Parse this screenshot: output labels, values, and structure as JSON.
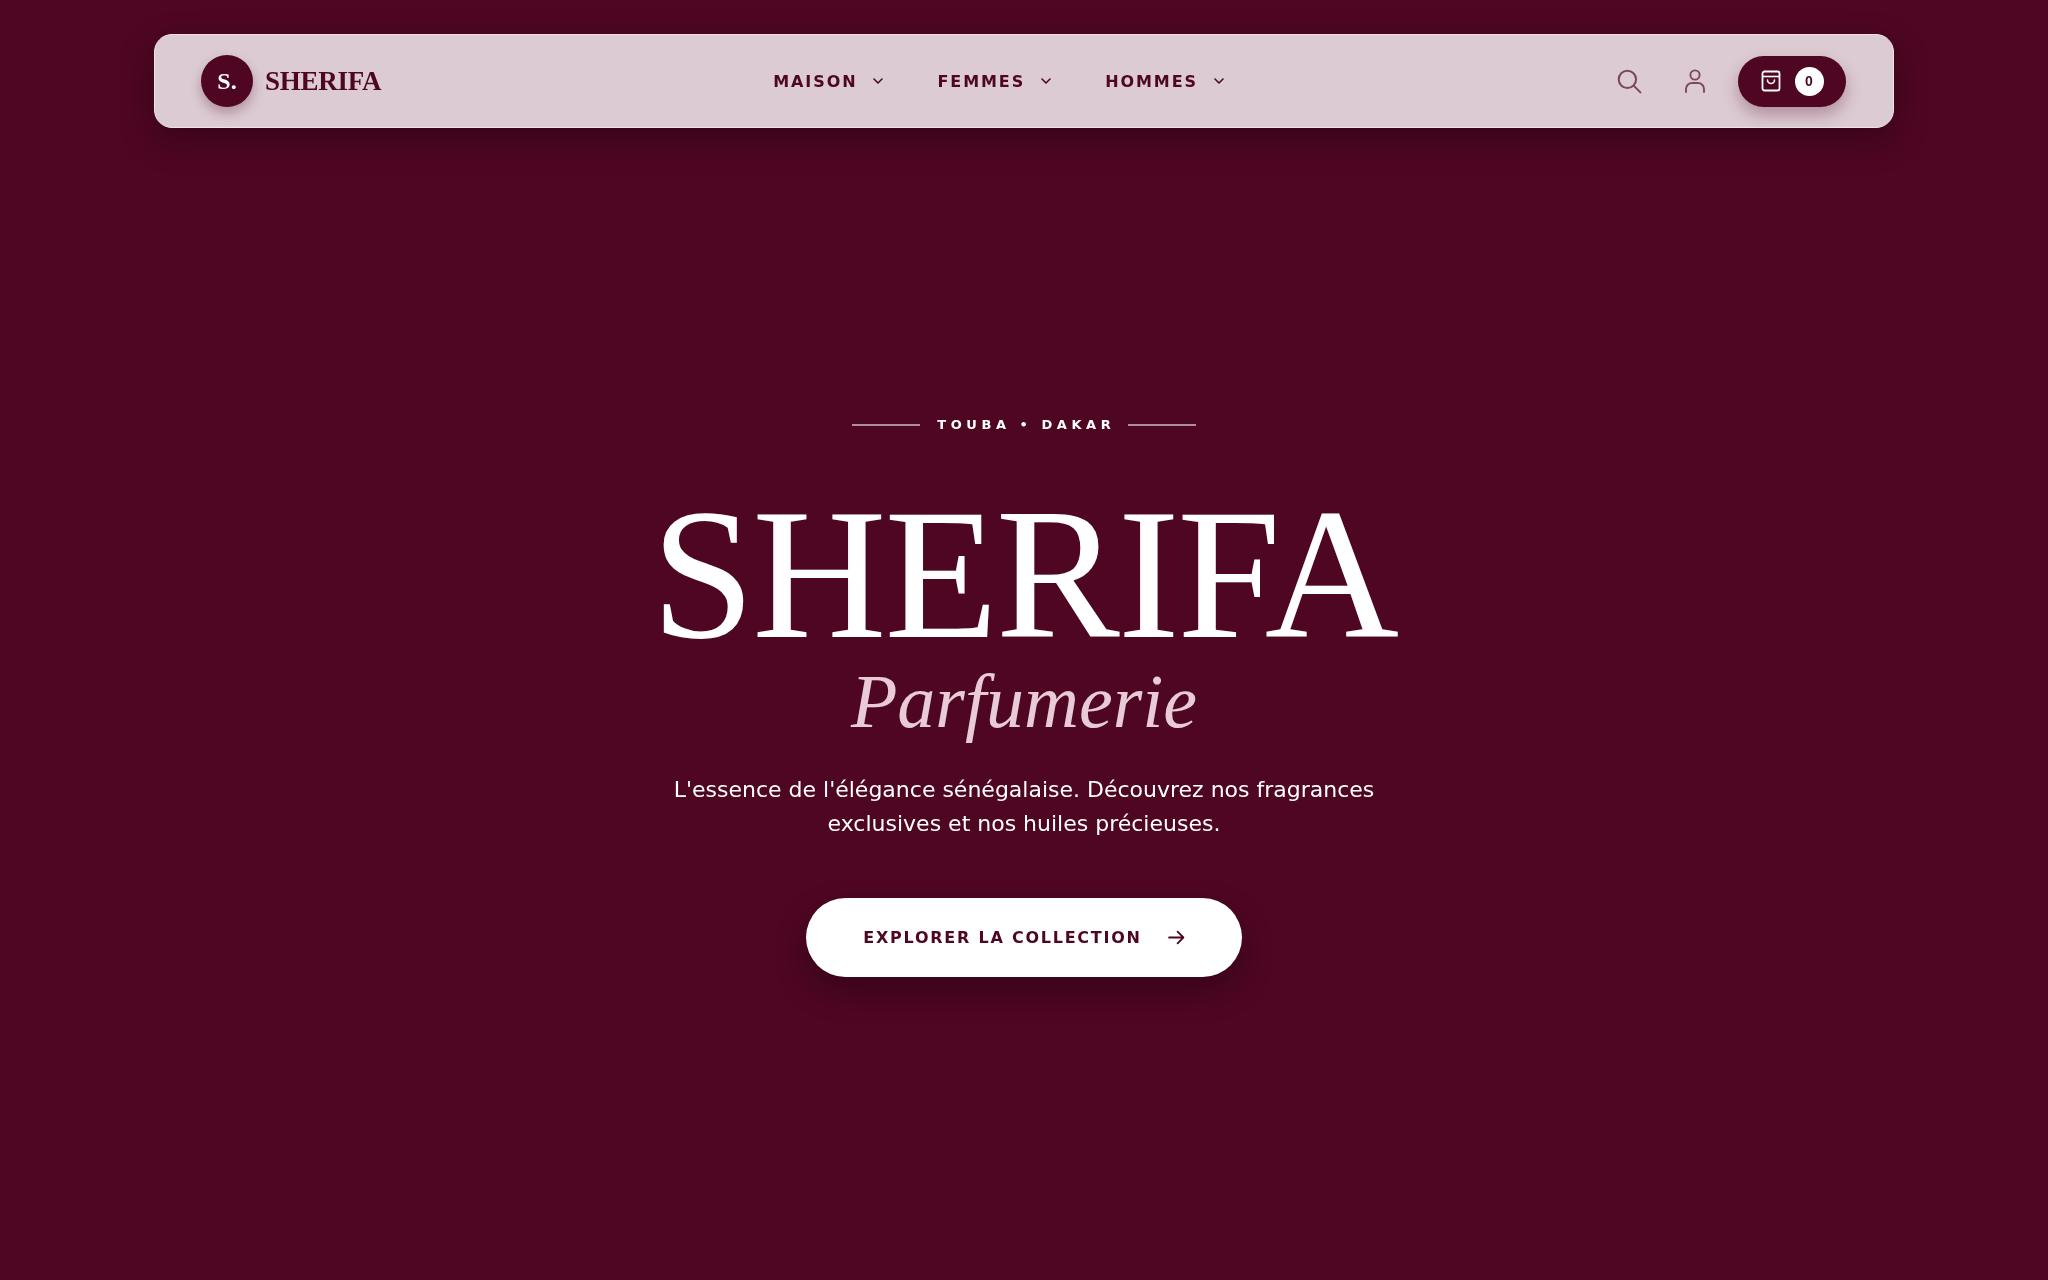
{
  "header": {
    "brand": {
      "monogram": "S.",
      "name": "SHERIFA"
    },
    "nav": [
      {
        "label": "MAISON",
        "dropdown": true
      },
      {
        "label": "FEMMES",
        "dropdown": true
      },
      {
        "label": "HOMMES",
        "dropdown": true
      }
    ],
    "cart": {
      "count": "0"
    }
  },
  "hero": {
    "eyebrow": "TOUBA • DAKAR",
    "title": "SHERIFA",
    "subtitle": "Parfumerie",
    "description": "L'essence de l'élégance sénégalaise. Découvrez nos fragrances exclusives et nos huiles précieuses.",
    "cta": "EXPLORER LA COLLECTION"
  }
}
